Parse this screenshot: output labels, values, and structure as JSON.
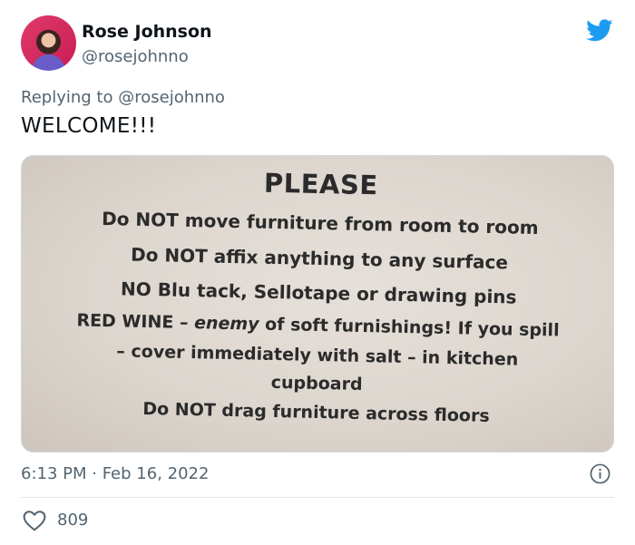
{
  "tweet": {
    "author_name": "Rose Johnson",
    "author_handle": "@rosejohnno",
    "replying_prefix": "Replying to",
    "replying_to": "@rosejohnno",
    "text": "WELCOME!!!",
    "timestamp": "6:13 PM · Feb 16, 2022",
    "like_count": "809"
  },
  "photo": {
    "title": "PLEASE",
    "lines": [
      "Do NOT move furniture from room to room",
      "Do NOT affix anything to any surface",
      "NO Blu tack, Sellotape or drawing pins"
    ],
    "line4_a": "RED WINE – ",
    "line4_em": "enemy",
    "line4_b": " of soft furnishings! If you spill",
    "line5": "– cover immediately with salt – in kitchen",
    "line6": "cupboard",
    "line7": "Do NOT drag furniture across floors"
  },
  "icons": {
    "brand": "twitter-bird-icon",
    "info": "info-icon",
    "like": "heart-icon"
  },
  "colors": {
    "brand": "#1d9bf0",
    "secondary_text": "#536471",
    "primary_text": "#0f1419"
  }
}
